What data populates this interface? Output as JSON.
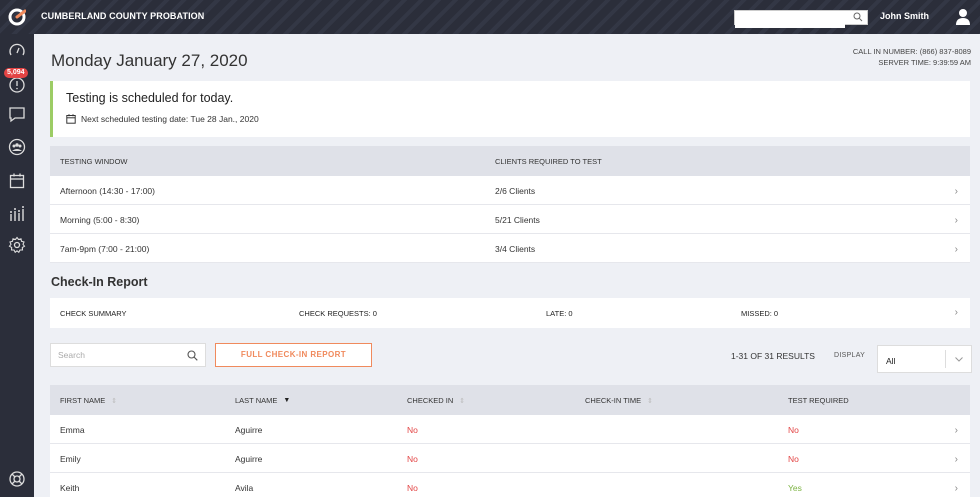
{
  "topbar": {
    "brand": "CUMBERLAND COUNTY PROBATION",
    "search_placeholder": "",
    "user_name": "John Smith"
  },
  "sidebar": {
    "badge": "5,094",
    "items": [
      "dashboard-icon",
      "alert-icon",
      "chat-icon",
      "group-icon",
      "calendar-icon",
      "reports-icon",
      "settings-icon",
      "help-icon"
    ]
  },
  "header": {
    "date": "Monday January 27, 2020",
    "call_in": "CALL IN NUMBER: (866) 837-8089",
    "server_time": "SERVER TIME: 9:39:59 AM"
  },
  "alert": {
    "title": "Testing is scheduled for today.",
    "next": "Next scheduled testing date: Tue 28 Jan., 2020"
  },
  "testing_table": {
    "headers": [
      "TESTING WINDOW",
      "CLIENTS REQUIRED TO TEST"
    ],
    "rows": [
      {
        "window": "Afternoon (14:30 - 17:00)",
        "clients": "2/6 Clients"
      },
      {
        "window": "Morning (5:00 - 8:30)",
        "clients": "5/21 Clients"
      },
      {
        "window": "7am-9pm (7:00 - 21:00)",
        "clients": "3/4 Clients"
      }
    ]
  },
  "checkin": {
    "title": "Check-In Report",
    "summary": {
      "label": "CHECK SUMMARY",
      "requests": "CHECK REQUESTS: 0",
      "late": "LATE: 0",
      "missed": "MISSED: 0"
    },
    "search_placeholder": "Search",
    "full_report": "FULL CHECK-IN REPORT",
    "results": "1-31 OF 31 RESULTS",
    "display_label": "DISPLAY",
    "display_value": "All",
    "headers": [
      "FIRST NAME",
      "LAST NAME",
      "CHECKED IN",
      "CHECK-IN TIME",
      "TEST REQUIRED"
    ],
    "rows": [
      {
        "first": "Emma",
        "last": "Aguirre",
        "checked_in": "No",
        "time": "",
        "test_required": "No"
      },
      {
        "first": "Emily",
        "last": "Aguirre",
        "checked_in": "No",
        "time": "",
        "test_required": "No"
      },
      {
        "first": "Keith",
        "last": "Avila",
        "checked_in": "No",
        "time": "",
        "test_required": "Yes"
      }
    ]
  },
  "colors": {
    "topbar": "#2b2e3a",
    "accent_orange": "#f08a5d",
    "no_red": "#e34444",
    "yes_green": "#7cb342",
    "alert_border": "#9ccc65"
  }
}
